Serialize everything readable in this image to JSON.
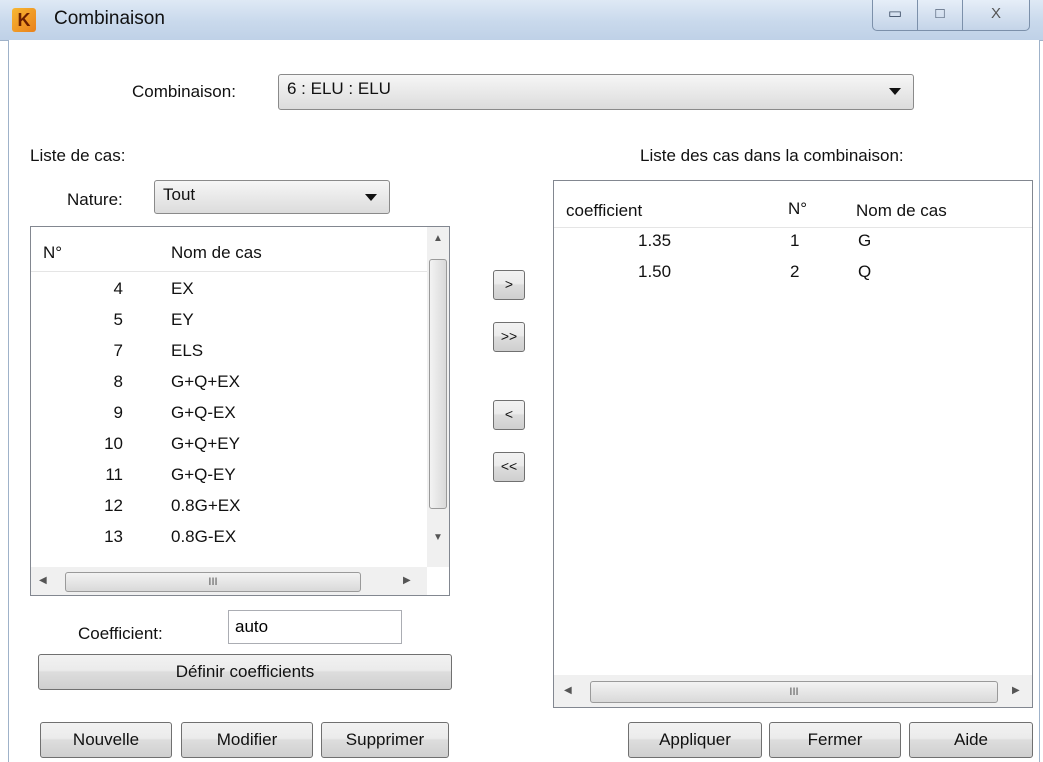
{
  "window": {
    "title": "Combinaison",
    "app_icon": "K"
  },
  "titlebar_buttons": {
    "minimize": "▭",
    "maximize": "□",
    "close": "X"
  },
  "combinaison": {
    "label": "Combinaison:",
    "selected": "6 : ELU : ELU"
  },
  "left": {
    "header": "Liste de cas:",
    "nature_label": "Nature:",
    "nature_selected": "Tout",
    "columns": [
      "N°",
      "Nom de cas"
    ],
    "rows": [
      {
        "n": "4",
        "name": "EX"
      },
      {
        "n": "5",
        "name": "EY"
      },
      {
        "n": "7",
        "name": "ELS"
      },
      {
        "n": "8",
        "name": "G+Q+EX"
      },
      {
        "n": "9",
        "name": "G+Q-EX"
      },
      {
        "n": "10",
        "name": "G+Q+EY"
      },
      {
        "n": "11",
        "name": "G+Q-EY"
      },
      {
        "n": "12",
        "name": "0.8G+EX"
      },
      {
        "n": "13",
        "name": "0.8G-EX"
      }
    ],
    "hscroll_grip": "III",
    "coefficient_label": "Coefficient:",
    "coefficient_value": "auto",
    "define_button": "Définir coefficients"
  },
  "transfer_buttons": {
    "add": ">",
    "add_all": ">>",
    "remove": "<",
    "remove_all": "<<"
  },
  "right": {
    "header": "Liste des cas dans la combinaison:",
    "columns": [
      "coefficient",
      "N°",
      "Nom de cas"
    ],
    "rows": [
      {
        "coef": "1.35",
        "n": "1",
        "name": "G"
      },
      {
        "coef": "1.50",
        "n": "2",
        "name": "Q"
      }
    ],
    "hscroll_grip": "III"
  },
  "bottom_buttons": {
    "nouvelle": "Nouvelle",
    "modifier": "Modifier",
    "supprimer": "Supprimer",
    "appliquer": "Appliquer",
    "fermer": "Fermer",
    "aide": "Aide"
  }
}
